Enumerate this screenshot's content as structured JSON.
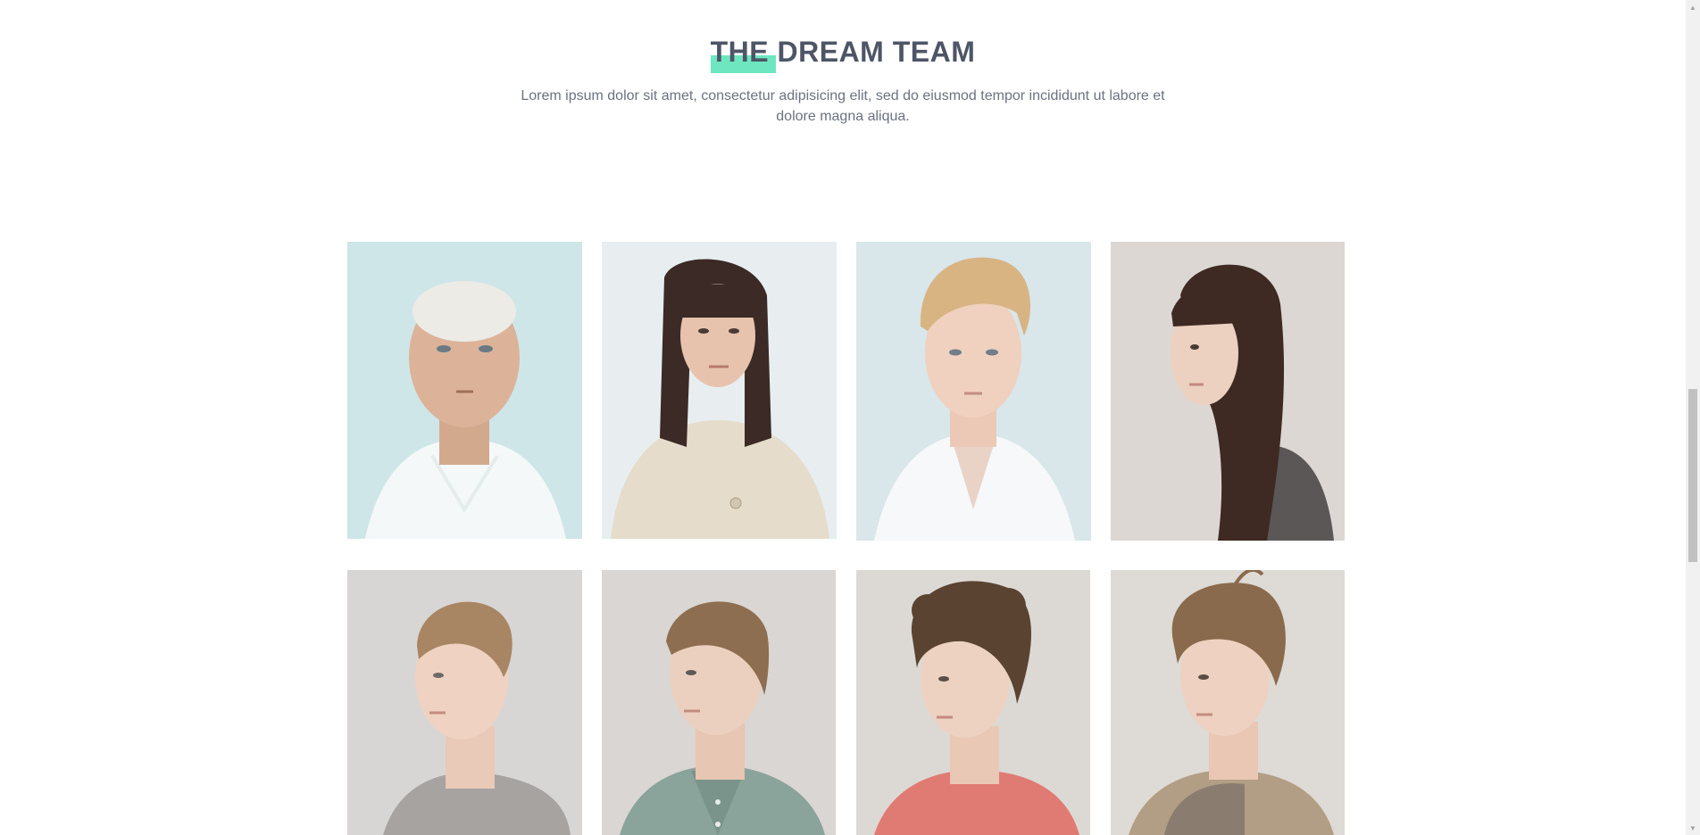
{
  "section": {
    "title_highlight": "THE",
    "title_rest": " DREAM TEAM",
    "subtitle": "Lorem ipsum dolor sit amet, consectetur adipisicing elit, sed do eiusmod tempor incididunt ut labore et dolore magna aliqua."
  },
  "team": [
    {
      "photo": "portrait-older-man-white-tshirt",
      "bg": "#cfe6e8"
    },
    {
      "photo": "portrait-woman-dark-hair-trench-coat",
      "bg": "#e8eef0"
    },
    {
      "photo": "portrait-blond-young-man-white-shirt",
      "bg": "#d9e6ea"
    },
    {
      "photo": "portrait-woman-long-brown-hair-profile",
      "bg": "#dcd7d3"
    },
    {
      "photo": "portrait-young-man-grey-sweater",
      "bg": "#d8d6d4"
    },
    {
      "photo": "portrait-young-man-green-shirt",
      "bg": "#d9d6d3"
    },
    {
      "photo": "portrait-curly-hair-man-coral-sweater",
      "bg": "#dcd9d5"
    },
    {
      "photo": "portrait-young-man-tousled-hair",
      "bg": "#dedad5"
    }
  ],
  "colors": {
    "accent": "#6ee7c1",
    "heading": "#4d5566",
    "text": "#6b7280"
  },
  "scrollbar": {
    "up_icon": "scroll-up-arrow-icon",
    "down_icon": "scroll-down-arrow-icon"
  }
}
